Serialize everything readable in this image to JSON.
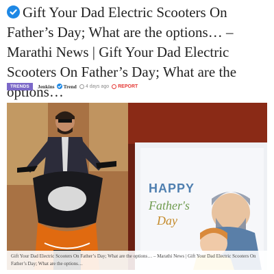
{
  "article": {
    "title": "Gift Your Dad Electric Scooters On Father’s Day; What are the options… – Marathi News | Gift Your Dad Electric Scooters On Father’s Day; What are the options…",
    "category_tag": "TRENDS",
    "author": "Jenkins",
    "author_badge": "Trend",
    "time_ago": "4 days ago",
    "report_label": "REPORT",
    "image_caption": "Gift Your Dad Electric Scooters On Father’s Day; What are the options… – Marathi News | Gift Your Dad Electric Scooters On Father’s Day; What are the options…",
    "card_text": {
      "happy": "HAPPY",
      "fathers": "Father's",
      "day": "Day"
    }
  },
  "icons": {
    "verified": "verified-check-icon",
    "clock": "clock-icon",
    "report": "report-icon"
  },
  "colors": {
    "verified": "#1e88e5",
    "tag_bg": "#7b68c8",
    "report": "#e53935"
  }
}
